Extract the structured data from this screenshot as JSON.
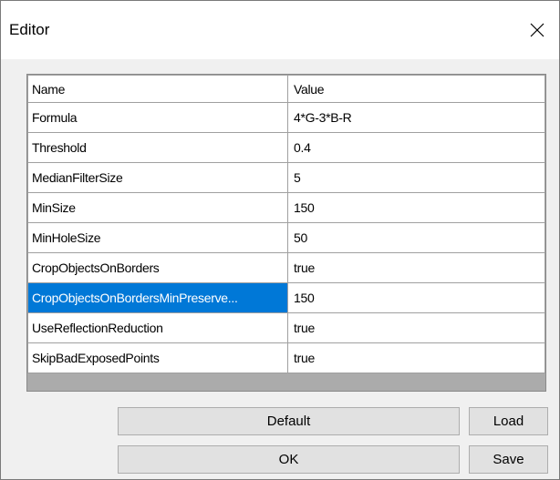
{
  "window": {
    "title": "Editor",
    "close_icon": "close-icon"
  },
  "grid": {
    "columns": [
      "Name",
      "Value"
    ],
    "rows": [
      {
        "name": "Formula",
        "value": "4*G-3*B-R"
      },
      {
        "name": "Threshold",
        "value": "0.4"
      },
      {
        "name": "MedianFilterSize",
        "value": "5"
      },
      {
        "name": "MinSize",
        "value": "150"
      },
      {
        "name": "MinHoleSize",
        "value": "50"
      },
      {
        "name": "CropObjectsOnBorders",
        "value": "true"
      },
      {
        "name": "CropObjectsOnBordersMinPreserve...",
        "value": "150"
      },
      {
        "name": "UseReflectionReduction",
        "value": "true"
      },
      {
        "name": "SkipBadExposedPoints",
        "value": "true"
      }
    ],
    "selected_row": 6,
    "selection_color": "#0078d7"
  },
  "buttons": {
    "default_label": "Default",
    "load_label": "Load",
    "ok_label": "OK",
    "save_label": "Save"
  }
}
